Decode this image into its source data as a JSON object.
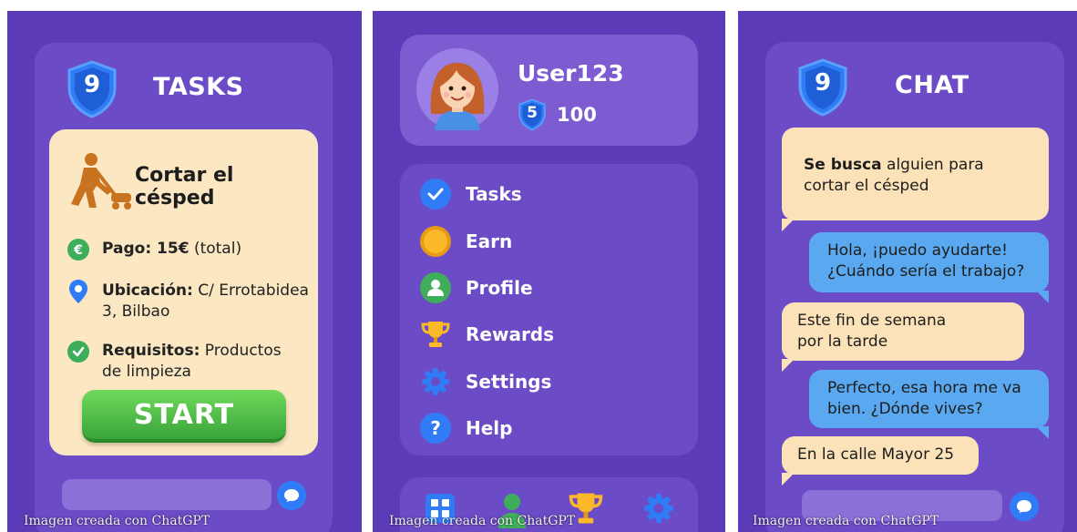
{
  "tasks_screen": {
    "level_badge": "9",
    "title": "TASKS",
    "task": {
      "title": "Cortar el césped",
      "icon": "lawn-mower-icon",
      "pay_label": "Pago: 15€",
      "pay_value": "(total)",
      "location_label": "Ubicación:",
      "location_value_line1": "C/ Errotabidea",
      "location_value_line2": "3, Bilbao",
      "requirements_label": "Requisitos:",
      "requirements_value_line1": "Productos",
      "requirements_value_line2": "de limpieza"
    },
    "start_label": "START",
    "watermark": "Imagen creada con ChatGPT"
  },
  "menu_screen": {
    "profile": {
      "username": "User123",
      "level_badge": "5",
      "points": "100"
    },
    "menu_items": [
      {
        "label": "Tasks",
        "icon": "check-circle-icon"
      },
      {
        "label": "Earn",
        "icon": "coin-icon"
      },
      {
        "label": "Profile",
        "icon": "user-circle-icon"
      },
      {
        "label": "Rewards",
        "icon": "trophy-icon"
      },
      {
        "label": "Settings",
        "icon": "gear-icon"
      },
      {
        "label": "Help",
        "icon": "help-icon"
      }
    ],
    "bottom_nav": [
      "grid-icon",
      "user-icon",
      "trophy-icon",
      "gear-icon"
    ],
    "watermark": "Imagen creada con ChatGPT"
  },
  "chat_screen": {
    "level_badge": "9",
    "title": "CHAT",
    "messages": [
      {
        "side": "in",
        "bold": "Se busca",
        "line1": " alguien para",
        "line2": "cortar el césped"
      },
      {
        "side": "out",
        "line1": "Hola, ¡puedo ayudarte!",
        "line2": "¿Cuándo sería el trabajo?"
      },
      {
        "side": "in",
        "line1": "Este fin de semana",
        "line2": "por la tarde"
      },
      {
        "side": "out",
        "line1": "Perfecto, esa hora me va",
        "line2": "bien. ¿Dónde vives?"
      },
      {
        "side": "in",
        "line1": "En la calle Mayor 25"
      }
    ],
    "watermark": "Imagen creada con ChatGPT"
  },
  "colors": {
    "background": "#5b3bb8",
    "card": "#6c4cc6",
    "task_card": "#fbe7c2",
    "start_button": "#4cbb45",
    "incoming_bubble": "#fbe2b8",
    "outgoing_bubble": "#5aa8ef",
    "badge_blue": "#2f7cf6"
  }
}
